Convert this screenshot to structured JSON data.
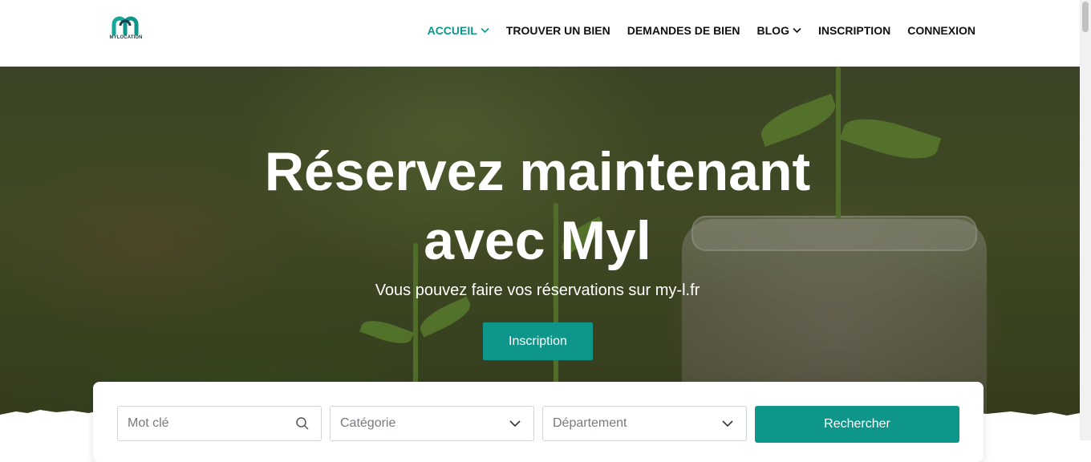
{
  "brand": {
    "logo_text": "MYLOCATION",
    "accent": "#0e968b"
  },
  "nav": {
    "items": [
      {
        "label": "ACCUEIL",
        "has_dropdown": true,
        "active": true
      },
      {
        "label": "TROUVER UN BIEN",
        "has_dropdown": false,
        "active": false
      },
      {
        "label": "DEMANDES DE BIEN",
        "has_dropdown": false,
        "active": false
      },
      {
        "label": "BLOG",
        "has_dropdown": true,
        "active": false
      },
      {
        "label": "INSCRIPTION",
        "has_dropdown": false,
        "active": false
      },
      {
        "label": "CONNEXION",
        "has_dropdown": false,
        "active": false
      }
    ]
  },
  "hero": {
    "title_line1": "Réservez maintenant",
    "title_line2": "avec Myl",
    "subtitle": "Vous pouvez faire vos réservations sur my-l.fr",
    "cta_label": "Inscription"
  },
  "search": {
    "keyword_placeholder": "Mot clé",
    "category_placeholder": "Catégorie",
    "department_placeholder": "Département",
    "submit_label": "Rechercher"
  },
  "icons": {
    "search": "search-icon",
    "chevron": "chevron-down-icon"
  }
}
